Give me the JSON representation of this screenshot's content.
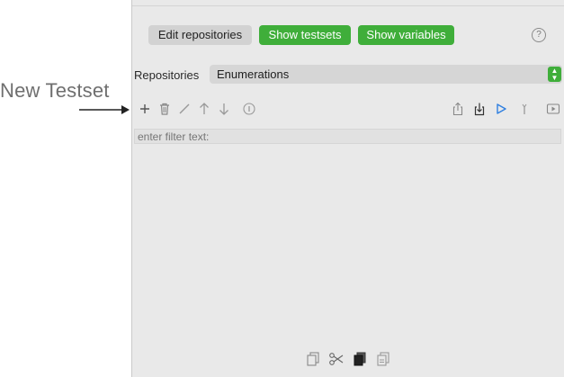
{
  "callout": {
    "label": "New Testset"
  },
  "header": {
    "edit_repositories": "Edit repositories",
    "show_testsets": "Show testsets",
    "show_variables": "Show variables",
    "help_glyph": "?"
  },
  "repositories": {
    "label": "Repositories",
    "selected": "Enumerations"
  },
  "toolbar_icons": [
    "add-icon",
    "trash-icon",
    "edit-icon",
    "up-arrow-icon",
    "down-arrow-icon",
    "info-icon",
    "export-icon",
    "import-icon",
    "play-icon",
    "run-single-icon",
    "play-box-icon"
  ],
  "filter": {
    "placeholder": "enter filter text:"
  },
  "bottom_icons": [
    "copy-icon",
    "cut-icon",
    "paste-icon",
    "duplicate-icon"
  ],
  "colors": {
    "accent_green": "#3fae3a",
    "play_blue": "#2f7fe0",
    "panel_bg": "#e9e9e9"
  }
}
